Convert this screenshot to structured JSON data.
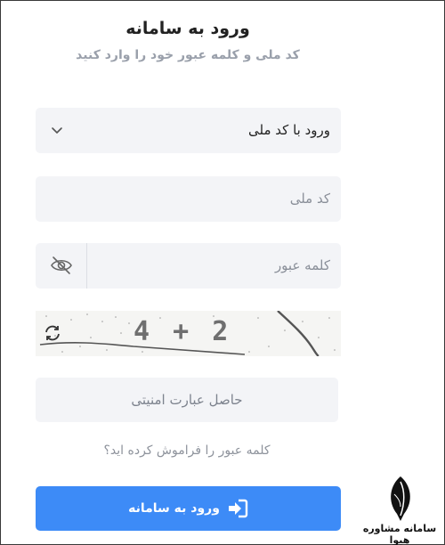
{
  "header": {
    "title": "ورود به سامانه",
    "subtitle": "کد ملی و کلمه عبور خود را وارد کنید"
  },
  "login_method": {
    "selected": "ورود با کد ملی"
  },
  "national_id": {
    "placeholder": "کد ملی"
  },
  "password": {
    "placeholder": "کلمه عبور"
  },
  "captcha": {
    "text": "4 + 2"
  },
  "captcha_answer": {
    "placeholder": "حاصل عبارت امنیتی"
  },
  "forgot_password": "کلمه عبور را فراموش کرده اید؟",
  "submit": {
    "label": "ورود به سامانه"
  },
  "watermark": {
    "text": "سامانه مشاوره هیوا"
  },
  "colors": {
    "accent": "#3d8bf7",
    "field_bg": "#f3f4f7",
    "muted_text": "#9aa0ab"
  },
  "icons": [
    "chevron-down-icon",
    "eye-off-icon",
    "refresh-icon",
    "login-icon",
    "quill-logo"
  ]
}
